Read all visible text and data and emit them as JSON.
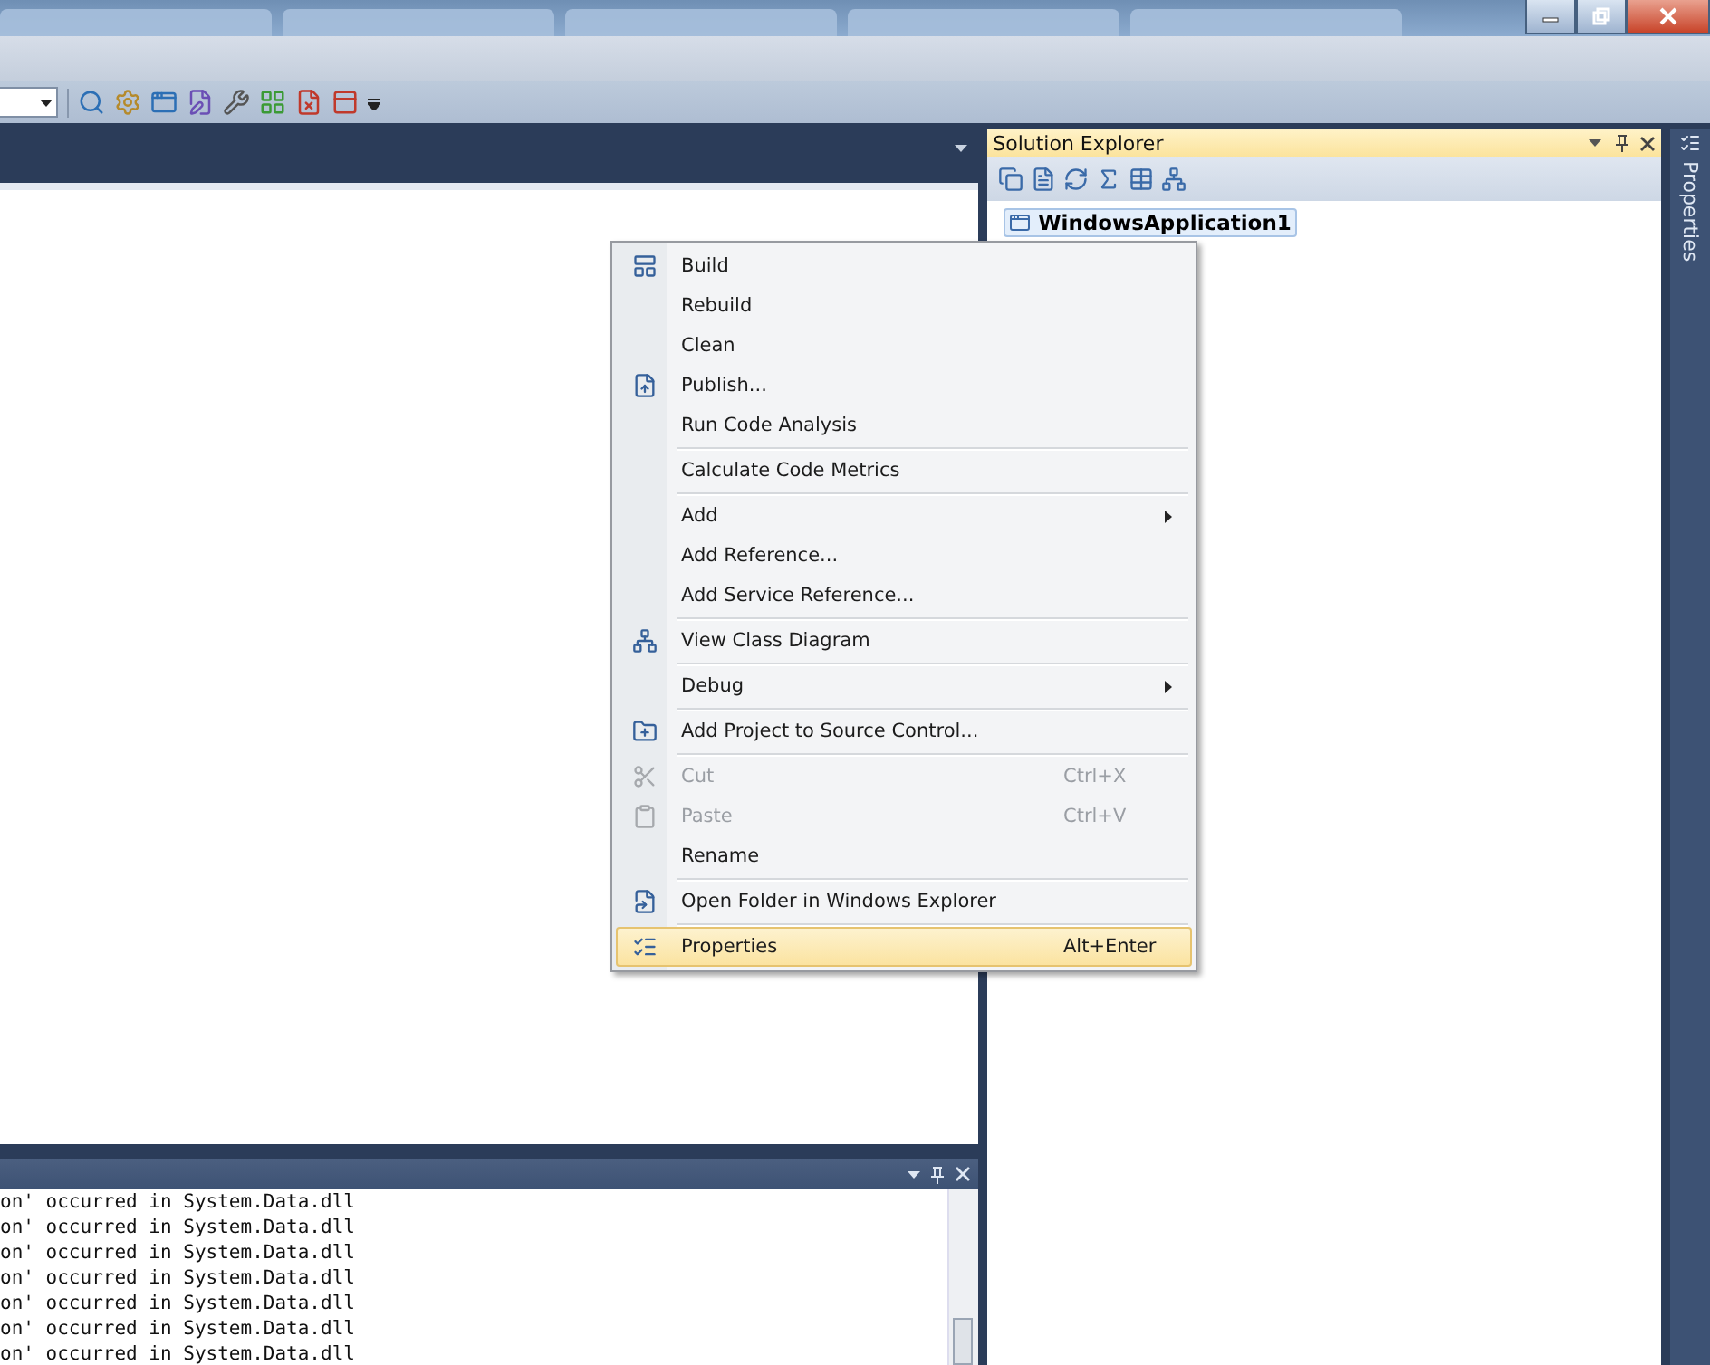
{
  "output_panel": {
    "lines": [
      "on' occurred in System.Data.dll",
      "on' occurred in System.Data.dll",
      "on' occurred in System.Data.dll",
      "on' occurred in System.Data.dll",
      "on' occurred in System.Data.dll",
      "on' occurred in System.Data.dll",
      "on' occurred in System.Data.dll"
    ]
  },
  "solution_explorer": {
    "title": "Solution Explorer",
    "tree": [
      {
        "label": "WindowsApplication1",
        "selected": true
      }
    ]
  },
  "side_tab": {
    "label": "Properties"
  },
  "context_menu": {
    "groups": [
      [
        {
          "label": "Build",
          "icon": true,
          "disabled": false,
          "selected": false
        },
        {
          "label": "Rebuild",
          "icon": false,
          "disabled": false,
          "selected": false
        },
        {
          "label": "Clean",
          "icon": false,
          "disabled": false,
          "selected": false
        },
        {
          "label": "Publish...",
          "icon": true,
          "disabled": false,
          "selected": false
        },
        {
          "label": "Run Code Analysis",
          "icon": false,
          "disabled": false,
          "selected": false
        }
      ],
      [
        {
          "label": "Calculate Code Metrics",
          "icon": false,
          "disabled": false,
          "selected": false
        }
      ],
      [
        {
          "label": "Add",
          "icon": false,
          "submenu": true,
          "disabled": false,
          "selected": false
        },
        {
          "label": "Add Reference...",
          "icon": false,
          "disabled": false,
          "selected": false
        },
        {
          "label": "Add Service Reference...",
          "icon": false,
          "disabled": false,
          "selected": false
        }
      ],
      [
        {
          "label": "View Class Diagram",
          "icon": true,
          "disabled": false,
          "selected": false
        }
      ],
      [
        {
          "label": "Debug",
          "icon": false,
          "submenu": true,
          "disabled": false,
          "selected": false
        }
      ],
      [
        {
          "label": "Add Project to Source Control...",
          "icon": true,
          "disabled": false,
          "selected": false
        }
      ],
      [
        {
          "label": "Cut",
          "icon": true,
          "shortcut": "Ctrl+X",
          "disabled": true,
          "selected": false
        },
        {
          "label": "Paste",
          "icon": true,
          "shortcut": "Ctrl+V",
          "disabled": true,
          "selected": false
        },
        {
          "label": "Rename",
          "icon": false,
          "disabled": false,
          "selected": false
        }
      ],
      [
        {
          "label": "Open Folder in Windows Explorer",
          "icon": true,
          "disabled": false,
          "selected": false
        }
      ],
      [
        {
          "label": "Properties",
          "icon": true,
          "shortcut": "Alt+Enter",
          "disabled": false,
          "selected": true
        }
      ]
    ]
  }
}
